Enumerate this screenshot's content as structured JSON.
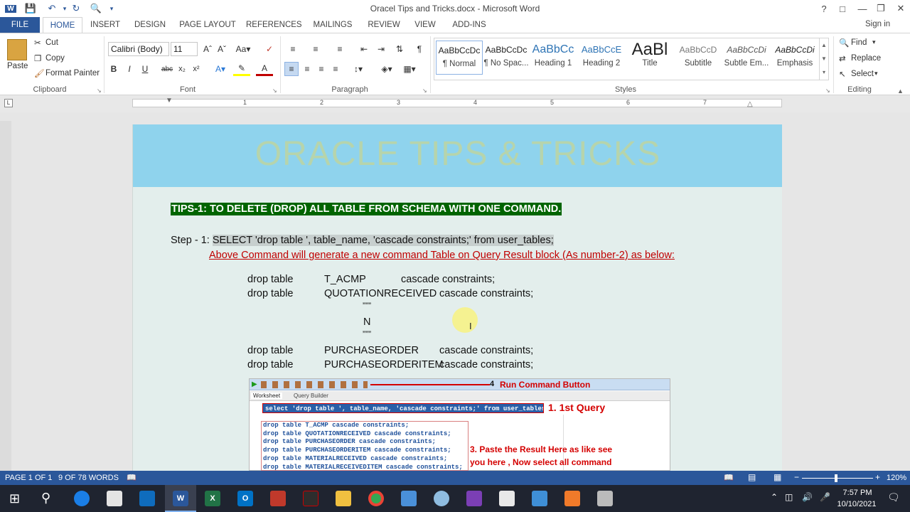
{
  "window": {
    "title": "Oracel Tips and Tricks.docx - Microsoft Word"
  },
  "tabs": [
    "FILE",
    "HOME",
    "INSERT",
    "DESIGN",
    "PAGE LAYOUT",
    "REFERENCES",
    "MAILINGS",
    "REVIEW",
    "VIEW",
    "ADD-INS"
  ],
  "signin": "Sign in",
  "clipboard": {
    "paste": "Paste",
    "cut": "Cut",
    "copy": "Copy",
    "format_painter": "Format Painter",
    "label": "Clipboard"
  },
  "font": {
    "name": "Calibri (Body)",
    "size": "11",
    "label": "Font",
    "bold": "B",
    "italic": "I",
    "underline": "U",
    "strike": "abc",
    "sub": "x₂",
    "sup": "x²"
  },
  "paragraph": {
    "label": "Paragraph"
  },
  "styles": {
    "label": "Styles",
    "items": [
      {
        "sample": "AaBbCcDc",
        "name": "¶ Normal"
      },
      {
        "sample": "AaBbCcDc",
        "name": "¶ No Spac..."
      },
      {
        "sample": "AaBbCc",
        "name": "Heading 1"
      },
      {
        "sample": "AaBbCcE",
        "name": "Heading 2"
      },
      {
        "sample": "AaBl",
        "name": "Title"
      },
      {
        "sample": "AaBbCcD",
        "name": "Subtitle"
      },
      {
        "sample": "AaBbCcDi",
        "name": "Subtle Em..."
      },
      {
        "sample": "AaBbCcDi",
        "name": "Emphasis"
      }
    ]
  },
  "editing": {
    "find": "Find",
    "replace": "Replace",
    "select": "Select",
    "label": "Editing"
  },
  "ruler_numbers": [
    "1",
    "2",
    "3",
    "4",
    "5",
    "6",
    "7"
  ],
  "document": {
    "banner": "ORACLE TIPS & TRICKS",
    "tips_heading": "TIPS-1: TO DELETE (DROP) ALL TABLE FROM SCHEMA WITH ONE COMMAND.",
    "step_label": "Step - 1: ",
    "step_sql": "SELECT 'drop table ', table_name, 'cascade constraints;' from user_tables;",
    "note": "Above Command will generate a new command Table on Query Result block (As number-2) as below:",
    "rows": [
      {
        "a": "drop table",
        "b": "T_ACMP",
        "c": "cascade constraints;"
      },
      {
        "a": "drop table",
        "b": "QUOTATIONRECEIVED",
        "c": "cascade constraints;"
      }
    ],
    "ellipsis1": "”””",
    "n_text": "N",
    "ellipsis2": "”””",
    "rows2": [
      {
        "a": "drop table",
        "b": "PURCHASEORDER",
        "c": "cascade constraints;"
      },
      {
        "a": "drop table",
        "b": "PURCHASEORDERITEM",
        "c": "cascade constraints;"
      }
    ]
  },
  "screenshot": {
    "run_label": "Run Command Button",
    "run_num": "4",
    "tab1": "Worksheet",
    "tab2": "Query Builder",
    "query": "select 'drop table ', table_name, 'cascade constraints;' from user_tables;",
    "q_label": "1. 1st Query",
    "results": [
      "drop table  T_ACMP  cascade constraints;",
      "drop table  QUOTATIONRECEIVED cascade constraints;",
      "drop table  PURCHASEORDER cascade constraints;",
      "drop table  PURCHASEORDERITEM cascade constraints;",
      "drop table  MATERIALRECEIVED  cascade constraints;",
      "drop table  MATERIALRECEIVEDITEM  cascade constraints;"
    ],
    "paste_note1": "3. Paste the Result Here as like see",
    "paste_note2": "you here , Now select all command"
  },
  "status": {
    "page": "PAGE 1 OF 1",
    "words": "9 OF 78 WORDS",
    "zoom": "120%"
  },
  "clock": {
    "time": "7:57 PM",
    "date": "10/10/2021"
  },
  "colors": {
    "word_blue": "#2b579a",
    "banner": "#8fd3ed",
    "heading_green": "#006400",
    "note_red": "#c00000"
  }
}
